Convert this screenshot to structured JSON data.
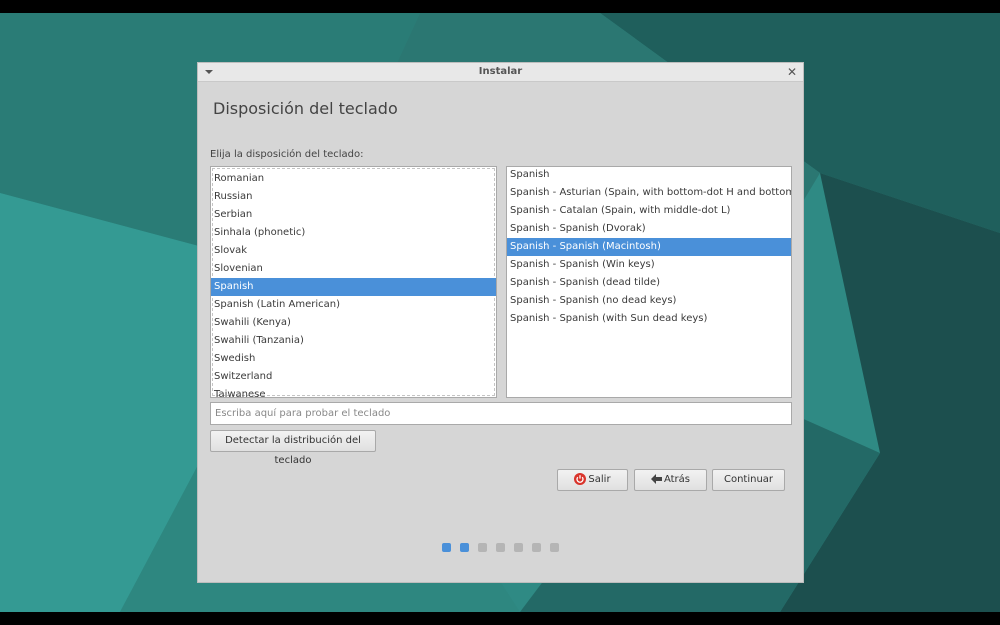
{
  "window": {
    "title": "Instalar"
  },
  "page": {
    "heading": "Disposición del teclado",
    "prompt": "Elija la disposición del teclado:"
  },
  "layouts": {
    "items": [
      "Romanian",
      "Russian",
      "Serbian",
      "Sinhala (phonetic)",
      "Slovak",
      "Slovenian",
      "Spanish",
      "Spanish (Latin American)",
      "Swahili (Kenya)",
      "Swahili (Tanzania)",
      "Swedish",
      "Switzerland",
      "Taiwanese"
    ],
    "selected": "Spanish"
  },
  "variants": {
    "items": [
      "Spanish",
      "Spanish - Asturian (Spain, with bottom-dot H and bottom-dot L)",
      "Spanish - Catalan (Spain, with middle-dot L)",
      "Spanish - Spanish (Dvorak)",
      "Spanish - Spanish (Macintosh)",
      "Spanish - Spanish (Win keys)",
      "Spanish - Spanish (dead tilde)",
      "Spanish - Spanish (no dead keys)",
      "Spanish - Spanish (with Sun dead keys)"
    ],
    "selected": "Spanish - Spanish (Macintosh)"
  },
  "test_input": {
    "placeholder": "Escriba aquí para probar el teclado"
  },
  "buttons": {
    "detect": "Detectar la distribución del teclado",
    "quit": "Salir",
    "back": "Atrás",
    "continue": "Continuar"
  },
  "icons": {
    "quit": "power-icon",
    "back": "arrow-left-icon",
    "window_menu": "chevron-down-icon",
    "close": "close-icon"
  },
  "progress": {
    "total_steps": 7,
    "current_step": 2
  },
  "colors": {
    "accent": "#4a90d9",
    "desktop": "#2b7f7a"
  }
}
